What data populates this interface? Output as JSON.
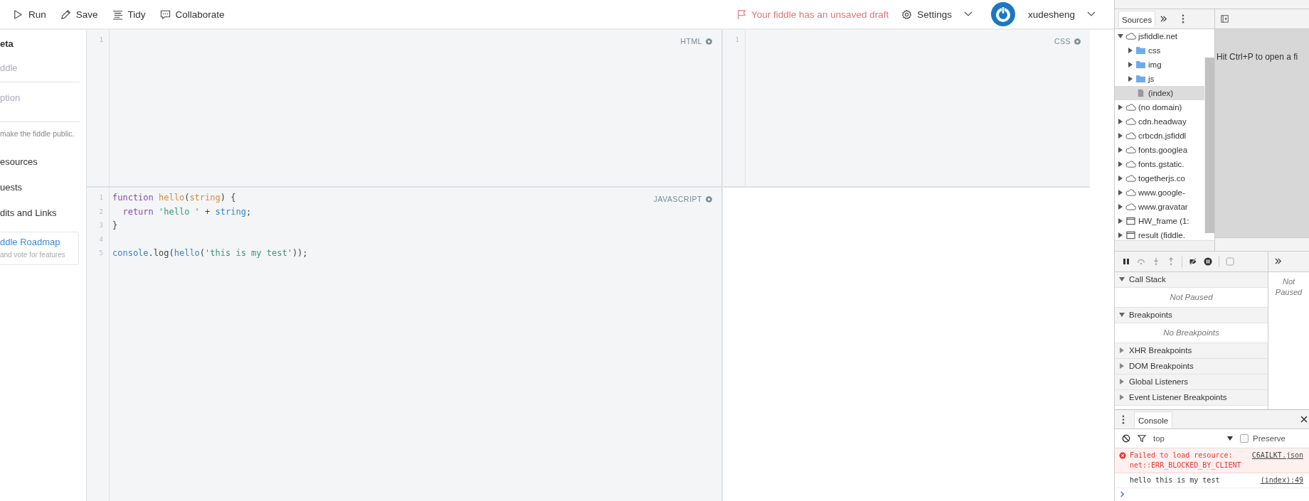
{
  "toolbar": {
    "actions": [
      {
        "label": "Run",
        "kind": "run"
      },
      {
        "label": "Save",
        "kind": "save"
      },
      {
        "label": "Tidy",
        "kind": "tidy"
      },
      {
        "label": "Collaborate",
        "kind": "collaborate"
      }
    ],
    "draft_notice": "Your fiddle has an unsaved draft",
    "settings": "Settings",
    "user": "xudesheng"
  },
  "sidebar": {
    "heading": "eta",
    "fields": [
      {
        "placeholder": "ddle"
      },
      {
        "placeholder": "ption"
      }
    ],
    "note": "make the fiddle public.",
    "links": [
      "esources",
      "uests",
      "dits and Links"
    ],
    "roadmap": {
      "title": "ddle Roadmap",
      "subtitle": "and vote for features"
    }
  },
  "editors": [
    {
      "label": "HTML",
      "lines": [
        {
          "number": "1"
        }
      ]
    },
    {
      "label": "CSS",
      "lines": [
        {
          "number": "1"
        }
      ]
    },
    {
      "label": "JAVASCRIPT",
      "lines": [
        {
          "number": "1",
          "tokens": [
            {
              "text": "function",
              "kind": "keyword"
            },
            {
              "text": " hello",
              "kind": "def"
            },
            {
              "text": "(",
              "kind": "plain"
            },
            {
              "text": "string",
              "kind": "def"
            },
            {
              "text": ") {",
              "kind": "plain"
            }
          ]
        },
        {
          "number": "2",
          "tokens": [
            {
              "text": "  return",
              "kind": "keyword"
            },
            {
              "text": " 'hello '",
              "kind": "string"
            },
            {
              "text": " + ",
              "kind": "plain"
            },
            {
              "text": "string",
              "kind": "variable"
            },
            {
              "text": ";",
              "kind": "plain"
            }
          ]
        },
        {
          "number": "3",
          "tokens": [
            {
              "text": "}",
              "kind": "plain"
            }
          ]
        },
        {
          "number": "4"
        },
        {
          "number": "5",
          "tokens": [
            {
              "text": "console",
              "kind": "variable"
            },
            {
              "text": ".log(",
              "kind": "plain"
            },
            {
              "text": "hello",
              "kind": "variable"
            },
            {
              "text": "(",
              "kind": "plain"
            },
            {
              "text": "'this is my test'",
              "kind": "string"
            },
            {
              "text": "));",
              "kind": "plain"
            }
          ]
        }
      ]
    }
  ],
  "devtools": {
    "navigator_tab": "Sources",
    "tree": [
      {
        "label": "jsfiddle.net",
        "kind": "domain",
        "expanded": true,
        "selected": false,
        "children": [
          {
            "label": "css",
            "kind": "folder",
            "expanded": false,
            "selected": false
          },
          {
            "label": "img",
            "kind": "folder",
            "expanded": false,
            "selected": false
          },
          {
            "label": "js",
            "kind": "folder",
            "expanded": false,
            "selected": false
          },
          {
            "label": "(index)",
            "kind": "file",
            "selected": true
          }
        ]
      },
      {
        "label": "(no domain)",
        "kind": "domain",
        "expanded": false,
        "selected": false
      },
      {
        "label": "cdn.headway",
        "kind": "domain",
        "expanded": false,
        "selected": false
      },
      {
        "label": "crbcdn.jsfiddl",
        "kind": "domain",
        "expanded": false,
        "selected": false
      },
      {
        "label": "fonts.googlea",
        "kind": "domain",
        "expanded": false,
        "selected": false
      },
      {
        "label": "fonts.gstatic.",
        "kind": "domain",
        "expanded": false,
        "selected": false
      },
      {
        "label": "togetherjs.co",
        "kind": "domain",
        "expanded": false,
        "selected": false
      },
      {
        "label": "www.google-",
        "kind": "domain",
        "expanded": false,
        "selected": false
      },
      {
        "label": "www.gravatar",
        "kind": "domain",
        "expanded": false,
        "selected": false
      },
      {
        "label": "HW_frame (1:",
        "kind": "frame",
        "expanded": false,
        "selected": false
      },
      {
        "label": "result (fiddle.",
        "kind": "frame",
        "expanded": false,
        "selected": false
      }
    ],
    "editor_hint": "Hit Ctrl+P to open a fi",
    "sections": [
      {
        "title": "Call Stack",
        "expanded": true,
        "message": "Not Paused"
      },
      {
        "title": "Breakpoints",
        "expanded": true,
        "message": "No Breakpoints"
      },
      {
        "title": "XHR Breakpoints",
        "expanded": false
      },
      {
        "title": "DOM Breakpoints",
        "expanded": false
      },
      {
        "title": "Global Listeners",
        "expanded": false
      },
      {
        "title": "Event Listener Breakpoints",
        "expanded": false
      }
    ],
    "scope_message": "Not Paused",
    "console": {
      "tab": "Console",
      "context": "top",
      "preserve_label": "Preserve",
      "preserve_checked": false,
      "messages": [
        {
          "kind": "error",
          "text": "Failed to load resource: net::ERR_BLOCKED_BY_CLIENT",
          "source": "C6AILKT.json"
        },
        {
          "kind": "log",
          "text": "hello this is my test",
          "source": "(index):49"
        }
      ]
    }
  }
}
